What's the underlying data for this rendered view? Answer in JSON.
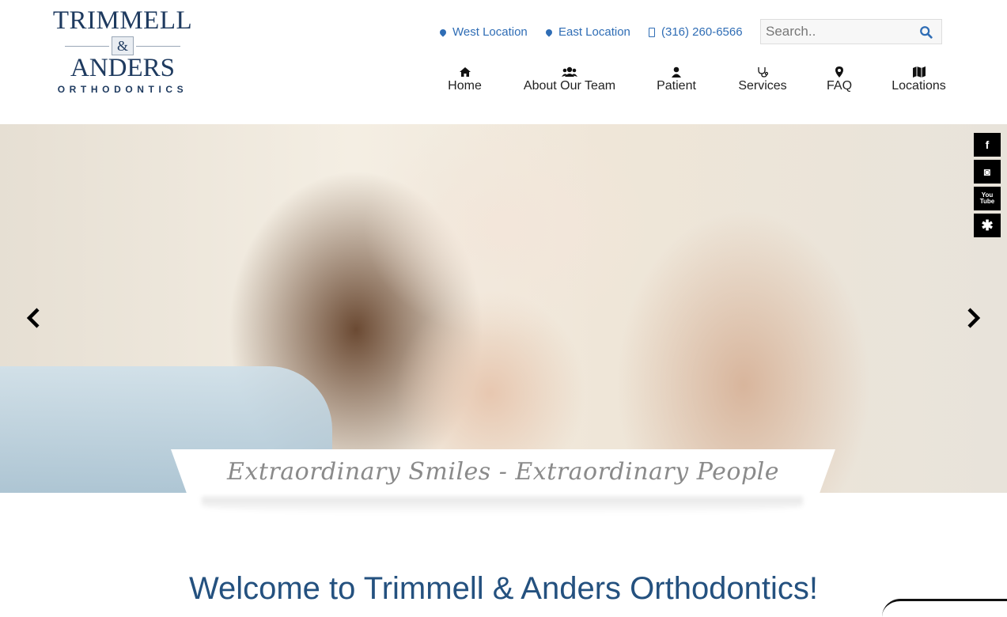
{
  "logo": {
    "line1": "TRIMMELL",
    "amp": "&",
    "line2": "ANDERS",
    "line3": "ORTHODONTICS"
  },
  "top_links": [
    {
      "label": "West Location",
      "icon": "map-marker-icon"
    },
    {
      "label": "East Location",
      "icon": "map-marker-icon"
    },
    {
      "label": "(316) 260-6566",
      "icon": "mobile-phone-icon"
    }
  ],
  "search": {
    "placeholder": "Search..",
    "value": ""
  },
  "nav": [
    {
      "label": "Home",
      "icon": "home-icon"
    },
    {
      "label": "About Our Team",
      "icon": "users-icon"
    },
    {
      "label": "Patient",
      "icon": "user-icon"
    },
    {
      "label": "Services",
      "icon": "stethoscope-icon"
    },
    {
      "label": "FAQ",
      "icon": "map-marker-icon"
    },
    {
      "label": "Locations",
      "icon": "map-icon"
    }
  ],
  "social": [
    "f",
    "◙",
    "You Tube",
    "✱"
  ],
  "hero": {
    "tagline": "Extraordinary Smiles - Extraordinary People"
  },
  "welcome": "Welcome to Trimmell & Anders Orthodontics!",
  "colors": {
    "accent": "#2f6db5",
    "heading": "#24517f",
    "logo": "#1e3a5f"
  }
}
